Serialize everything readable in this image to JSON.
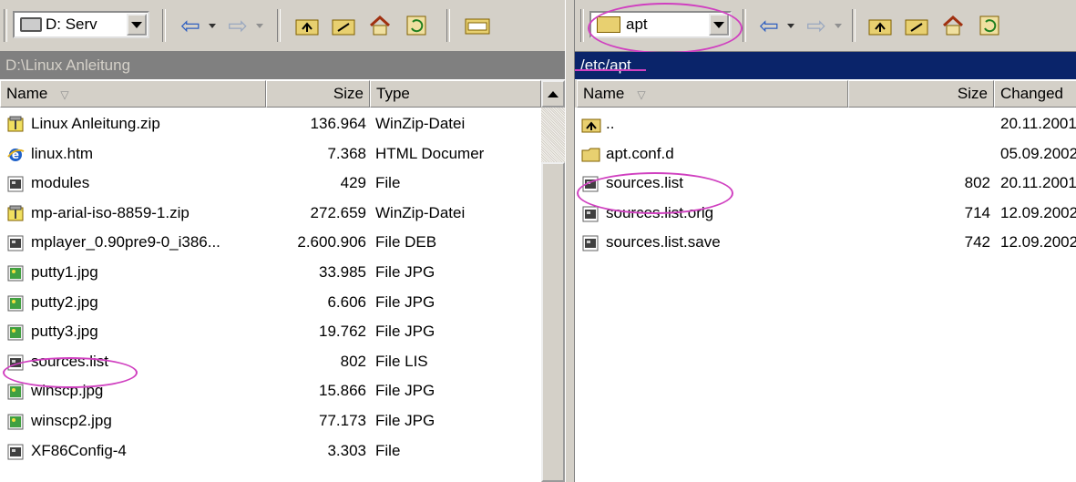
{
  "left": {
    "drive_combo": "D: Serv",
    "path": "D:\\Linux Anleitung",
    "columns": {
      "name": "Name",
      "size": "Size",
      "type": "Type"
    },
    "files": [
      {
        "name": "Linux Anleitung.zip",
        "size": "136.964",
        "type": "WinZip-Datei",
        "icon": "zip-icon"
      },
      {
        "name": "linux.htm",
        "size": "7.368",
        "type": "HTML Documer",
        "icon": "ie-html-icon"
      },
      {
        "name": "modules",
        "size": "429",
        "type": "File",
        "icon": "file-icon"
      },
      {
        "name": "mp-arial-iso-8859-1.zip",
        "size": "272.659",
        "type": "WinZip-Datei",
        "icon": "zip-icon"
      },
      {
        "name": "mplayer_0.90pre9-0_i386...",
        "size": "2.600.906",
        "type": "File DEB",
        "icon": "file-icon"
      },
      {
        "name": "putty1.jpg",
        "size": "33.985",
        "type": "File JPG",
        "icon": "image-icon"
      },
      {
        "name": "putty2.jpg",
        "size": "6.606",
        "type": "File JPG",
        "icon": "image-icon"
      },
      {
        "name": "putty3.jpg",
        "size": "19.762",
        "type": "File JPG",
        "icon": "image-icon"
      },
      {
        "name": "sources.list",
        "size": "802",
        "type": "File LIS",
        "icon": "file-icon"
      },
      {
        "name": "winscp.jpg",
        "size": "15.866",
        "type": "File JPG",
        "icon": "image-icon"
      },
      {
        "name": "winscp2.jpg",
        "size": "77.173",
        "type": "File JPG",
        "icon": "image-icon"
      },
      {
        "name": "XF86Config-4",
        "size": "3.303",
        "type": "File",
        "icon": "file-icon"
      }
    ]
  },
  "right": {
    "dir_combo": "apt",
    "path": "/etc/apt",
    "columns": {
      "name": "Name",
      "size": "Size",
      "changed": "Changed"
    },
    "files": [
      {
        "name": "..",
        "size": "",
        "changed": "20.11.2001",
        "icon": "parent-folder-icon"
      },
      {
        "name": "apt.conf.d",
        "size": "",
        "changed": "05.09.2002",
        "icon": "folder-icon"
      },
      {
        "name": "sources.list",
        "size": "802",
        "changed": "20.11.2001",
        "icon": "file-icon"
      },
      {
        "name": "sources.list.orig",
        "size": "714",
        "changed": "12.09.2002",
        "icon": "file-icon"
      },
      {
        "name": "sources.list.save",
        "size": "742",
        "changed": "12.09.2002",
        "icon": "file-icon"
      }
    ]
  },
  "colors": {
    "annotation": "#d040c0",
    "active_path_bg": "#0a246a",
    "inactive_path_bg": "#808080"
  }
}
